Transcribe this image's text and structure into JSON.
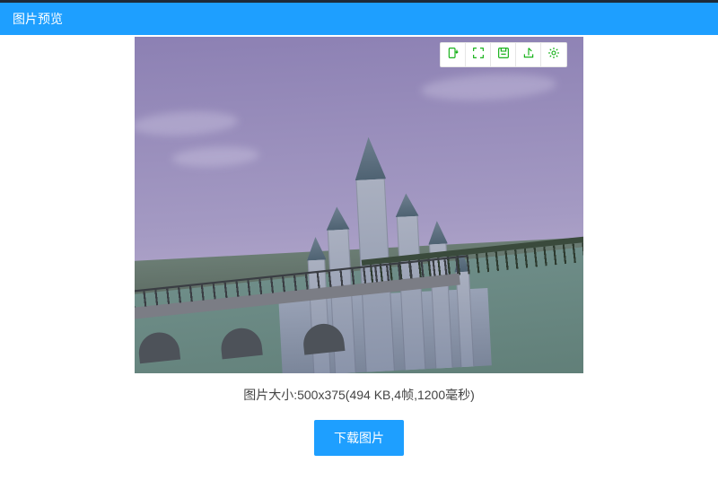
{
  "header": {
    "title": "图片预览"
  },
  "toolbar": {
    "rotate_label": "rotate",
    "fullscreen_label": "fullscreen",
    "save_label": "save",
    "share_label": "share",
    "settings_label": "settings"
  },
  "preview": {
    "info_text": "图片大小:500x375(494 KB,4帧,1200毫秒)",
    "download_label": "下载图片"
  }
}
